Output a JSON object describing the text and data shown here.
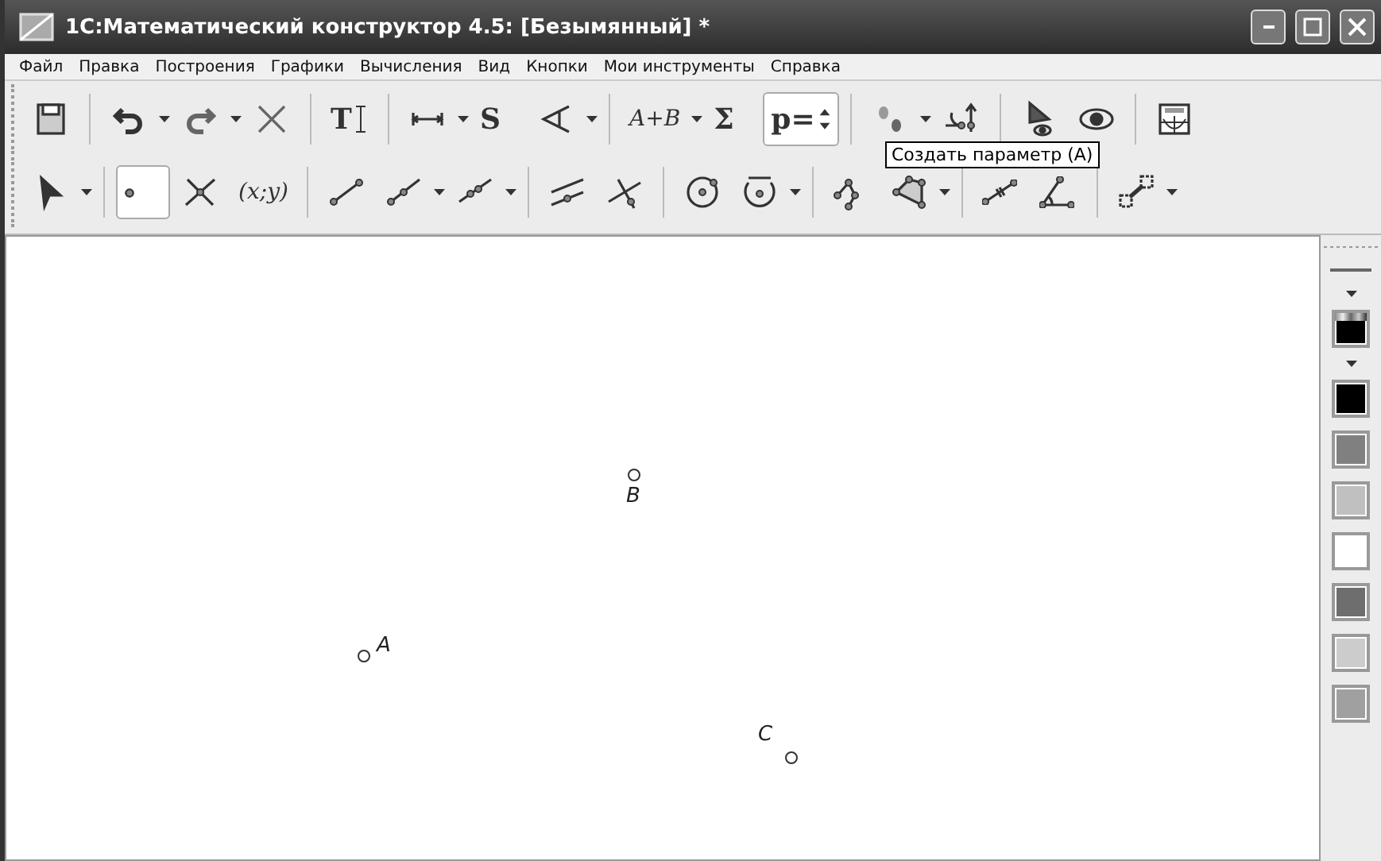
{
  "window": {
    "title": "1С:Математический конструктор 4.5: [Безымянный] *"
  },
  "menu": [
    "Файл",
    "Правка",
    "Построения",
    "Графики",
    "Вычисления",
    "Вид",
    "Кнопки",
    "Мои инструменты",
    "Справка"
  ],
  "toolbars": [
    [
      {
        "kind": "icon",
        "dropdown": false,
        "pressed": false
      },
      {
        "kind": "separator"
      },
      {
        "kind": "icon",
        "dropdown": true,
        "pressed": false
      },
      {
        "kind": "icon",
        "dropdown": true,
        "pressed": false
      },
      {
        "kind": "icon",
        "dropdown": false,
        "pressed": false
      },
      {
        "kind": "separator"
      },
      {
        "kind": "glyph",
        "text": "T",
        "dropdown": false,
        "pressed": false
      },
      {
        "kind": "separator"
      },
      {
        "kind": "icon",
        "dropdown": true,
        "pressed": false
      },
      {
        "kind": "glyph",
        "text": "S",
        "dropdown": false,
        "pressed": false
      },
      {
        "kind": "icon",
        "dropdown": true,
        "pressed": false
      },
      {
        "kind": "separator"
      },
      {
        "kind": "glyph",
        "text": "A+B",
        "dropdown": true,
        "pressed": false
      },
      {
        "kind": "glyph",
        "text": "Σ",
        "dropdown": false,
        "pressed": false
      },
      {
        "kind": "glyph",
        "text": "p=",
        "dropdown": false,
        "pressed": true
      },
      {
        "kind": "separator"
      },
      {
        "kind": "icon",
        "dropdown": true,
        "pressed": false
      },
      {
        "kind": "icon",
        "dropdown": false,
        "pressed": false
      },
      {
        "kind": "separator"
      },
      {
        "kind": "icon",
        "dropdown": false,
        "pressed": false
      },
      {
        "kind": "icon",
        "dropdown": false,
        "pressed": false
      },
      {
        "kind": "separator"
      },
      {
        "kind": "icon",
        "dropdown": false,
        "pressed": false
      }
    ],
    [
      {
        "kind": "icon",
        "dropdown": true,
        "pressed": false
      },
      {
        "kind": "separator"
      },
      {
        "kind": "icon",
        "dropdown": false,
        "pressed": true
      },
      {
        "kind": "icon",
        "dropdown": false,
        "pressed": false
      },
      {
        "kind": "glyph",
        "text": "(x;y)",
        "dropdown": false,
        "pressed": false
      },
      {
        "kind": "separator"
      },
      {
        "kind": "icon",
        "dropdown": false,
        "pressed": false
      },
      {
        "kind": "icon",
        "dropdown": true,
        "pressed": false
      },
      {
        "kind": "icon",
        "dropdown": true,
        "pressed": false
      },
      {
        "kind": "separator"
      },
      {
        "kind": "icon",
        "dropdown": false,
        "pressed": false
      },
      {
        "kind": "icon",
        "dropdown": false,
        "pressed": false
      },
      {
        "kind": "separator"
      },
      {
        "kind": "icon",
        "dropdown": false,
        "pressed": false
      },
      {
        "kind": "icon",
        "dropdown": true,
        "pressed": false
      },
      {
        "kind": "separator"
      },
      {
        "kind": "icon",
        "dropdown": false,
        "pressed": false
      },
      {
        "kind": "icon",
        "dropdown": true,
        "pressed": false
      },
      {
        "kind": "separator"
      },
      {
        "kind": "icon",
        "dropdown": false,
        "pressed": false
      },
      {
        "kind": "icon",
        "dropdown": false,
        "pressed": false
      },
      {
        "kind": "separator"
      },
      {
        "kind": "icon",
        "dropdown": true,
        "pressed": false
      }
    ]
  ],
  "tooltip": "Создать параметр (А)",
  "points": [
    {
      "label": "B",
      "kind": "below"
    },
    {
      "label": "A",
      "kind": "right"
    },
    {
      "label": "C",
      "kind": "above"
    }
  ],
  "palette": [
    {
      "color": "#000000",
      "kind": "gradient"
    },
    {
      "color": "#000000",
      "kind": "plain"
    },
    {
      "color": "#808080",
      "kind": "plain"
    },
    {
      "color": "#c0c0c0",
      "kind": "plain"
    },
    {
      "color": "#ffffff",
      "kind": "plain"
    },
    {
      "color": "#6e6e6e",
      "kind": "plain"
    },
    {
      "color": "#cccccc",
      "kind": "plain"
    },
    {
      "color": "#a0a0a0",
      "kind": "plain"
    }
  ]
}
